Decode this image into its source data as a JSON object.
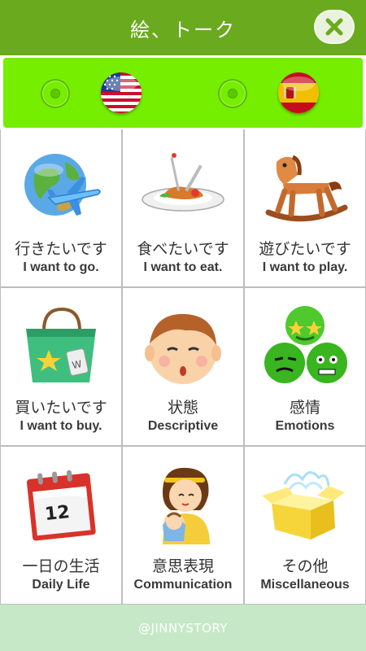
{
  "header": {
    "title": "絵、トーク",
    "close_icon": "close-icon",
    "color": "#6aaa1e"
  },
  "language_bar": {
    "color": "#76ee00",
    "options": [
      {
        "flag": "us-flag-icon",
        "selected": false
      },
      {
        "flag": "spain-flag-icon",
        "selected": false
      }
    ]
  },
  "categories": [
    {
      "jp": "行きたいです",
      "en": "I want to go.",
      "icon": "globe-airplane-icon"
    },
    {
      "jp": "食べたいです",
      "en": "I want to eat.",
      "icon": "food-plate-icon"
    },
    {
      "jp": "遊びたいです",
      "en": "I want to play.",
      "icon": "rocking-horse-icon"
    },
    {
      "jp": "買いたいです",
      "en": "I want to buy.",
      "icon": "shopping-bag-icon"
    },
    {
      "jp": "状態",
      "en": "Descriptive",
      "icon": "child-face-icon"
    },
    {
      "jp": "感情",
      "en": "Emotions",
      "icon": "emotion-faces-icon"
    },
    {
      "jp": "一日の生活",
      "en": "Daily Life",
      "icon": "calendar-icon"
    },
    {
      "jp": "意思表現",
      "en": "Communication",
      "icon": "mother-baby-icon"
    },
    {
      "jp": "その他",
      "en": "Miscellaneous",
      "icon": "open-box-icon"
    }
  ],
  "calendar_day": "12",
  "footer": {
    "text": "@JINNYSTORY",
    "color": "#c6e8c6"
  }
}
